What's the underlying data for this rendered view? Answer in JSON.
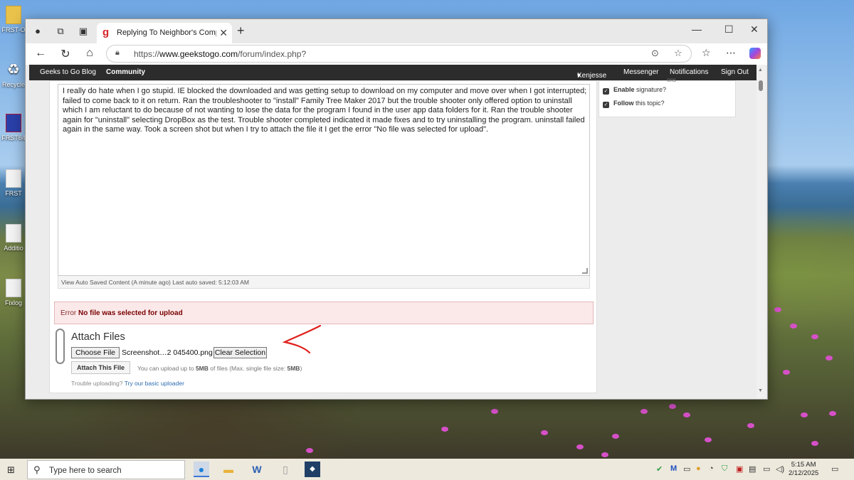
{
  "desktop": {
    "icons": [
      {
        "label": "FRST-O"
      },
      {
        "label": "Recycle"
      },
      {
        "label": "FRST64"
      },
      {
        "label": "FRST"
      },
      {
        "label": "Additio"
      },
      {
        "label": "Fixlog"
      }
    ]
  },
  "browser": {
    "tab_title": "Replying To Neighbor's Computer",
    "url_scheme": "https://",
    "url_host": "www.geekstogo.com",
    "url_path": "/forum/index.php?"
  },
  "site_nav": {
    "blog": "Geeks to Go Blog",
    "community": "Community",
    "user": "Kenjesse",
    "messenger": "Messenger",
    "notifications": "Notifications",
    "sign_out": "Sign Out"
  },
  "editor": {
    "body": "I really do hate when I go stupid.  IE blocked the downloaded and was getting setup to download on my computer and move over when I got interrupted; failed to come back to it on return.  Ran the troubleshooter to \"install\" Family Tree Maker 2017 but the trouble shooter only offered option to uninstall which I am reluctant to do because of not wanting to lose the data for the program I found in the user app data folders for it.  Ran the trouble shooter again for \"uninstall\" selecting DropBox as the test.  Trouble shooter completed indicated it made fixes and to try uninstalling the program. uninstall failed again in the same way.  Took a screen shot but when I try to attach the file it I get the error \"No file was selected for upload\".",
    "status_saved_link": "View Auto Saved Content (A minute ago)",
    "status_last_saved": "Last auto saved: 5:12:03 AM"
  },
  "error": {
    "prefix": "Error",
    "message": "No file was selected for upload"
  },
  "attach": {
    "title": "Attach Files",
    "choose_label": "Choose File",
    "file_name": "Screenshot…2 045400.png",
    "clear_label": "Clear Selection",
    "attach_label": "Attach This File",
    "note_prefix": "You can upload up to",
    "note_limit": "5MB",
    "note_mid": "of files (Max. single file size:",
    "note_single": "5MB",
    "note_suffix": ")",
    "trouble_text": "Trouble uploading?",
    "trouble_link": "Try our basic uploader"
  },
  "options": {
    "partial_label": "ons",
    "signature_bold": "Enable",
    "signature_rest": "signature?",
    "follow_bold": "Follow",
    "follow_rest": "this topic?"
  },
  "taskbar": {
    "search_placeholder": "Type here to search",
    "time": "5:15 AM",
    "date": "2/12/2025"
  },
  "colors": {
    "error_bg": "#fbe9ea",
    "nav_bg": "#2c2c2c",
    "link": "#2d6bb0",
    "annotation_arrow": "#e0201c"
  }
}
